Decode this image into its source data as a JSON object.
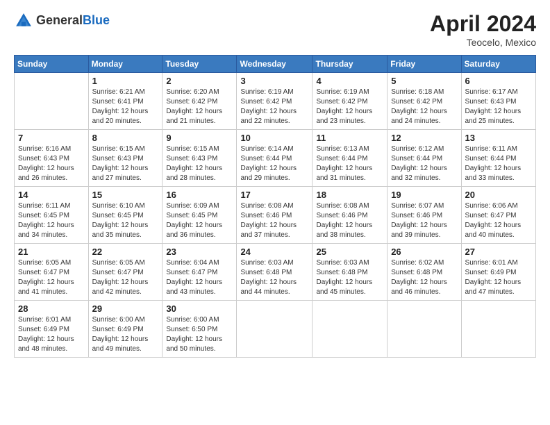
{
  "header": {
    "logo_general": "General",
    "logo_blue": "Blue",
    "month_year": "April 2024",
    "location": "Teocelo, Mexico"
  },
  "days_of_week": [
    "Sunday",
    "Monday",
    "Tuesday",
    "Wednesday",
    "Thursday",
    "Friday",
    "Saturday"
  ],
  "weeks": [
    [
      {
        "day": "",
        "sunrise": "",
        "sunset": "",
        "daylight": ""
      },
      {
        "day": "1",
        "sunrise": "Sunrise: 6:21 AM",
        "sunset": "Sunset: 6:41 PM",
        "daylight": "Daylight: 12 hours and 20 minutes."
      },
      {
        "day": "2",
        "sunrise": "Sunrise: 6:20 AM",
        "sunset": "Sunset: 6:42 PM",
        "daylight": "Daylight: 12 hours and 21 minutes."
      },
      {
        "day": "3",
        "sunrise": "Sunrise: 6:19 AM",
        "sunset": "Sunset: 6:42 PM",
        "daylight": "Daylight: 12 hours and 22 minutes."
      },
      {
        "day": "4",
        "sunrise": "Sunrise: 6:19 AM",
        "sunset": "Sunset: 6:42 PM",
        "daylight": "Daylight: 12 hours and 23 minutes."
      },
      {
        "day": "5",
        "sunrise": "Sunrise: 6:18 AM",
        "sunset": "Sunset: 6:42 PM",
        "daylight": "Daylight: 12 hours and 24 minutes."
      },
      {
        "day": "6",
        "sunrise": "Sunrise: 6:17 AM",
        "sunset": "Sunset: 6:43 PM",
        "daylight": "Daylight: 12 hours and 25 minutes."
      }
    ],
    [
      {
        "day": "7",
        "sunrise": "Sunrise: 6:16 AM",
        "sunset": "Sunset: 6:43 PM",
        "daylight": "Daylight: 12 hours and 26 minutes."
      },
      {
        "day": "8",
        "sunrise": "Sunrise: 6:15 AM",
        "sunset": "Sunset: 6:43 PM",
        "daylight": "Daylight: 12 hours and 27 minutes."
      },
      {
        "day": "9",
        "sunrise": "Sunrise: 6:15 AM",
        "sunset": "Sunset: 6:43 PM",
        "daylight": "Daylight: 12 hours and 28 minutes."
      },
      {
        "day": "10",
        "sunrise": "Sunrise: 6:14 AM",
        "sunset": "Sunset: 6:44 PM",
        "daylight": "Daylight: 12 hours and 29 minutes."
      },
      {
        "day": "11",
        "sunrise": "Sunrise: 6:13 AM",
        "sunset": "Sunset: 6:44 PM",
        "daylight": "Daylight: 12 hours and 31 minutes."
      },
      {
        "day": "12",
        "sunrise": "Sunrise: 6:12 AM",
        "sunset": "Sunset: 6:44 PM",
        "daylight": "Daylight: 12 hours and 32 minutes."
      },
      {
        "day": "13",
        "sunrise": "Sunrise: 6:11 AM",
        "sunset": "Sunset: 6:44 PM",
        "daylight": "Daylight: 12 hours and 33 minutes."
      }
    ],
    [
      {
        "day": "14",
        "sunrise": "Sunrise: 6:11 AM",
        "sunset": "Sunset: 6:45 PM",
        "daylight": "Daylight: 12 hours and 34 minutes."
      },
      {
        "day": "15",
        "sunrise": "Sunrise: 6:10 AM",
        "sunset": "Sunset: 6:45 PM",
        "daylight": "Daylight: 12 hours and 35 minutes."
      },
      {
        "day": "16",
        "sunrise": "Sunrise: 6:09 AM",
        "sunset": "Sunset: 6:45 PM",
        "daylight": "Daylight: 12 hours and 36 minutes."
      },
      {
        "day": "17",
        "sunrise": "Sunrise: 6:08 AM",
        "sunset": "Sunset: 6:46 PM",
        "daylight": "Daylight: 12 hours and 37 minutes."
      },
      {
        "day": "18",
        "sunrise": "Sunrise: 6:08 AM",
        "sunset": "Sunset: 6:46 PM",
        "daylight": "Daylight: 12 hours and 38 minutes."
      },
      {
        "day": "19",
        "sunrise": "Sunrise: 6:07 AM",
        "sunset": "Sunset: 6:46 PM",
        "daylight": "Daylight: 12 hours and 39 minutes."
      },
      {
        "day": "20",
        "sunrise": "Sunrise: 6:06 AM",
        "sunset": "Sunset: 6:47 PM",
        "daylight": "Daylight: 12 hours and 40 minutes."
      }
    ],
    [
      {
        "day": "21",
        "sunrise": "Sunrise: 6:05 AM",
        "sunset": "Sunset: 6:47 PM",
        "daylight": "Daylight: 12 hours and 41 minutes."
      },
      {
        "day": "22",
        "sunrise": "Sunrise: 6:05 AM",
        "sunset": "Sunset: 6:47 PM",
        "daylight": "Daylight: 12 hours and 42 minutes."
      },
      {
        "day": "23",
        "sunrise": "Sunrise: 6:04 AM",
        "sunset": "Sunset: 6:47 PM",
        "daylight": "Daylight: 12 hours and 43 minutes."
      },
      {
        "day": "24",
        "sunrise": "Sunrise: 6:03 AM",
        "sunset": "Sunset: 6:48 PM",
        "daylight": "Daylight: 12 hours and 44 minutes."
      },
      {
        "day": "25",
        "sunrise": "Sunrise: 6:03 AM",
        "sunset": "Sunset: 6:48 PM",
        "daylight": "Daylight: 12 hours and 45 minutes."
      },
      {
        "day": "26",
        "sunrise": "Sunrise: 6:02 AM",
        "sunset": "Sunset: 6:48 PM",
        "daylight": "Daylight: 12 hours and 46 minutes."
      },
      {
        "day": "27",
        "sunrise": "Sunrise: 6:01 AM",
        "sunset": "Sunset: 6:49 PM",
        "daylight": "Daylight: 12 hours and 47 minutes."
      }
    ],
    [
      {
        "day": "28",
        "sunrise": "Sunrise: 6:01 AM",
        "sunset": "Sunset: 6:49 PM",
        "daylight": "Daylight: 12 hours and 48 minutes."
      },
      {
        "day": "29",
        "sunrise": "Sunrise: 6:00 AM",
        "sunset": "Sunset: 6:49 PM",
        "daylight": "Daylight: 12 hours and 49 minutes."
      },
      {
        "day": "30",
        "sunrise": "Sunrise: 6:00 AM",
        "sunset": "Sunset: 6:50 PM",
        "daylight": "Daylight: 12 hours and 50 minutes."
      },
      {
        "day": "",
        "sunrise": "",
        "sunset": "",
        "daylight": ""
      },
      {
        "day": "",
        "sunrise": "",
        "sunset": "",
        "daylight": ""
      },
      {
        "day": "",
        "sunrise": "",
        "sunset": "",
        "daylight": ""
      },
      {
        "day": "",
        "sunrise": "",
        "sunset": "",
        "daylight": ""
      }
    ]
  ]
}
